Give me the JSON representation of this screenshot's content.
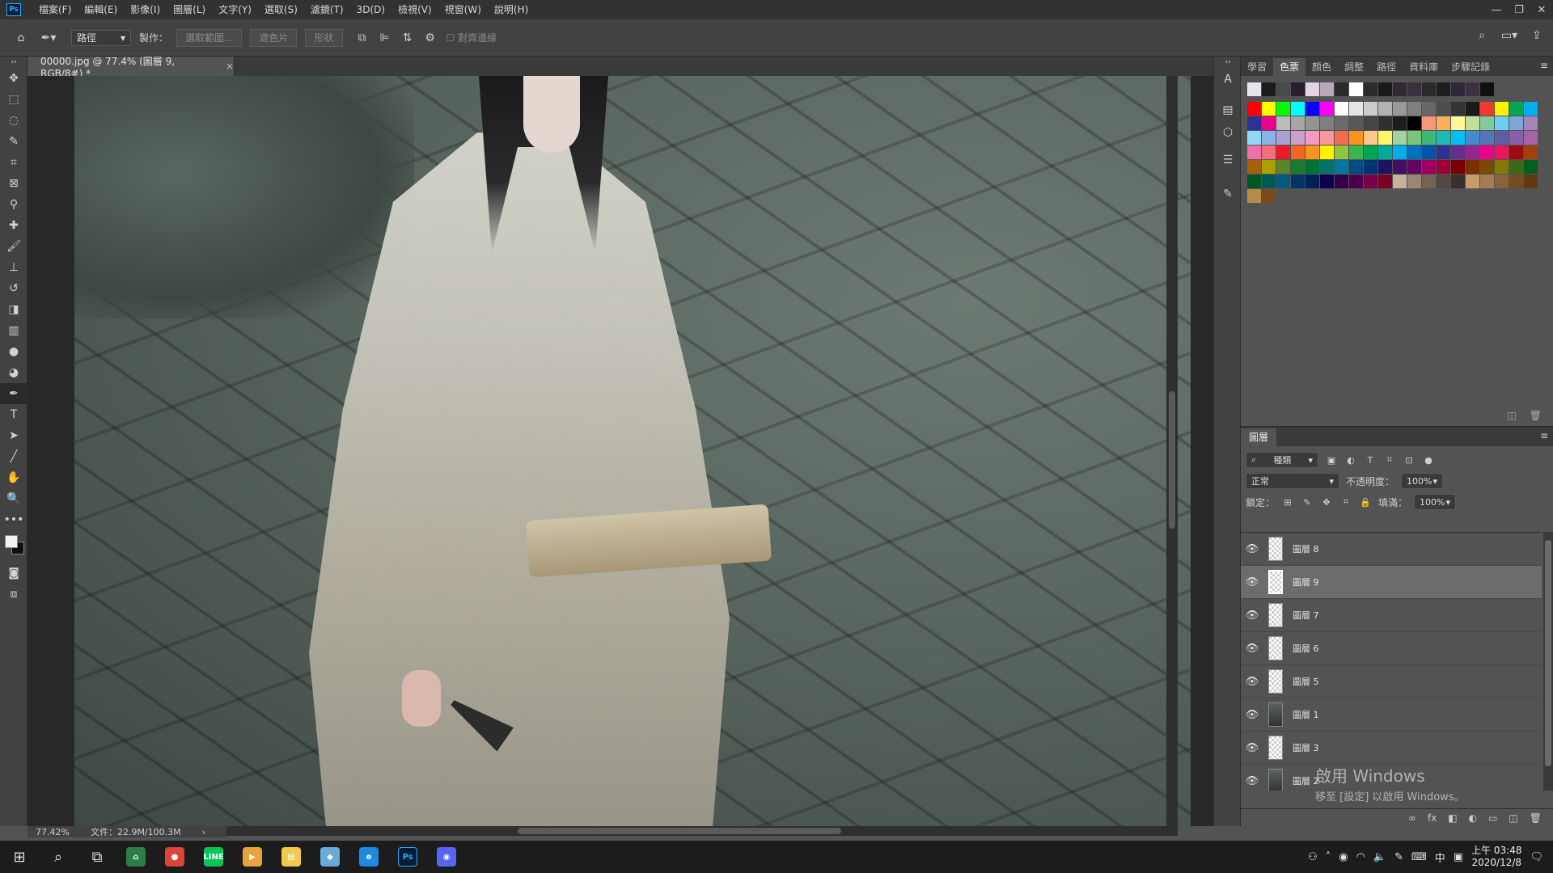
{
  "app": {
    "logo": "Ps"
  },
  "menu": [
    "檔案(F)",
    "編輯(E)",
    "影像(I)",
    "圖層(L)",
    "文字(Y)",
    "選取(S)",
    "濾鏡(T)",
    "3D(D)",
    "檢視(V)",
    "視窗(W)",
    "說明(H)"
  ],
  "window_controls": {
    "minimize": "—",
    "restore": "❐",
    "close": "✕"
  },
  "options": {
    "mode_select": "路徑",
    "make_label": "製作：",
    "selection_button": "選取範圍...",
    "mask_button": "遮色片",
    "shape_button": "形狀",
    "auto_align_label": "對齊邊緣"
  },
  "document": {
    "tab_title": "00000.jpg @ 77.4% (圖層 9, RGB/8#) *",
    "tab_close": "×",
    "zoom": "77.42%",
    "file_info": "文件：22.9M/100.3M",
    "status_arrow": "›"
  },
  "swatches_panel": {
    "tabs": [
      "學習",
      "色票",
      "顏色",
      "調整",
      "路徑",
      "資料庫",
      "步驟記錄"
    ],
    "active_tab": 1,
    "menu_icon": "≡",
    "recent": [
      "#e8e4ee",
      "#1c1c1c",
      "#4a4a4a",
      "#2a1e2e",
      "#e6d2e6",
      "#b8a8b8",
      "#2a2a2a",
      "#ffffff",
      "#2c2c2c",
      "#1a1a1a",
      "#2e2a30",
      "#3a3040",
      "#2a2a2a",
      "#1e1e1e",
      "#302838",
      "#3a3242",
      "#101010"
    ],
    "grid": [
      [
        "#ff0000",
        "#ffff00",
        "#00ff00",
        "#00ffff",
        "#0000ff",
        "#ff00ff",
        "#ffffff",
        "#e6e6e6",
        "#cdcdcd",
        "#b3b3b3",
        "#9a9a9a",
        "#808080",
        "#676767",
        "#4d4d4d",
        "#343434",
        "#1a1a1a",
        "#f23a2c",
        "#fff200",
        "#00a650",
        "#00aeef"
      ],
      [
        "#2e3192",
        "#ec008c",
        "#bbbbbb",
        "#a6a6a6",
        "#939393",
        "#7f7f7f",
        "#6b6b6b",
        "#585858",
        "#444444",
        "#303030",
        "#1d1d1d",
        "#000000",
        "#f7977a",
        "#fbaf5d",
        "#fff799",
        "#c4df9b",
        "#82ca9c",
        "#6ecff6",
        "#7ea7d8",
        "#a187be"
      ],
      [
        "#8ed8f8",
        "#8db3e2",
        "#a8a0d6",
        "#c7a0cb",
        "#f39bc1",
        "#f6989d",
        "#f26c4f",
        "#f7941d",
        "#fdc68a",
        "#fff568",
        "#a3d39c",
        "#7cc576",
        "#3bb878",
        "#1abbb4",
        "#00bff3",
        "#438ccb",
        "#5574b9",
        "#605ca8",
        "#855fa8",
        "#a763a8"
      ],
      [
        "#f06eaa",
        "#f26d7d",
        "#ed1c24",
        "#f26522",
        "#f7941d",
        "#fff200",
        "#8dc63f",
        "#39b54a",
        "#00a651",
        "#00a99d",
        "#00aeef",
        "#0072bc",
        "#0054a6",
        "#2e3192",
        "#662d91",
        "#92278f",
        "#ec008c",
        "#ed145b",
        "#9e0b0f",
        "#a0410d"
      ],
      [
        "#a36209",
        "#aba000",
        "#598527",
        "#197b30",
        "#007236",
        "#00746b",
        "#0076a3",
        "#004b80",
        "#003471",
        "#1b1464",
        "#440e62",
        "#630460",
        "#9e005d",
        "#9e0039",
        "#790000",
        "#7b2e00",
        "#7d4900",
        "#827b00",
        "#406618",
        "#005e20"
      ],
      [
        "#005826",
        "#005952",
        "#005b7f",
        "#003663",
        "#002157",
        "#0d004c",
        "#32004b",
        "#4b0049",
        "#7b0046",
        "#7a0026",
        "#c7b299",
        "#998675",
        "#736357",
        "#534741",
        "#37302d",
        "#c69c6d",
        "#a67c52",
        "#8c6239",
        "#754c24",
        "#603913"
      ]
    ],
    "grid_tail": [
      "#b88a4a",
      "#7a4a1a"
    ],
    "foot_new": "◫",
    "foot_delete": "🗑"
  },
  "layers_panel": {
    "title": "圖層",
    "menu_icon": "≡",
    "filter_label": "種類",
    "blend_mode": "正常",
    "opacity_label": "不透明度：",
    "opacity_value": "100%",
    "lock_label": "鎖定：",
    "fill_label": "填滿：",
    "fill_value": "100%",
    "layers": [
      {
        "name": "圖層 8",
        "thumb": "transparent",
        "selected": false
      },
      {
        "name": "圖層 9",
        "thumb": "transparent",
        "selected": true
      },
      {
        "name": "圖層 7",
        "thumb": "transparent",
        "selected": false
      },
      {
        "name": "圖層 6",
        "thumb": "transparent",
        "selected": false
      },
      {
        "name": "圖層 5",
        "thumb": "transparent",
        "selected": false
      },
      {
        "name": "圖層 1",
        "thumb": "photo",
        "selected": false
      },
      {
        "name": "圖層 3",
        "thumb": "transparent",
        "selected": false
      },
      {
        "name": "圖層 2",
        "thumb": "photo",
        "selected": false
      }
    ],
    "eye": "👁",
    "foot": [
      "∞",
      "fx",
      "◧",
      "◐",
      "▭",
      "◫",
      "🗑"
    ]
  },
  "watermark": {
    "title": "啟用 Windows",
    "subtitle": "移至 [設定] 以啟用 Windows。"
  },
  "taskbar": {
    "apps": [
      {
        "label": "⌂",
        "color": "#2d7d46"
      },
      {
        "label": "●",
        "color": "#db4437"
      },
      {
        "label": "LINE",
        "color": "#06c755"
      },
      {
        "label": "▶",
        "color": "#e8a33d"
      },
      {
        "label": "▤",
        "color": "#f2c94c"
      },
      {
        "label": "◆",
        "color": "#6aa9d8"
      },
      {
        "label": "e",
        "color": "#1e88e5"
      },
      {
        "label": "Ps",
        "color": "#001e36"
      },
      {
        "label": "◉",
        "color": "#5865f2"
      }
    ],
    "tray_ime": "中",
    "clock_time": "上午 03:48",
    "clock_date": "2020/12/8"
  }
}
